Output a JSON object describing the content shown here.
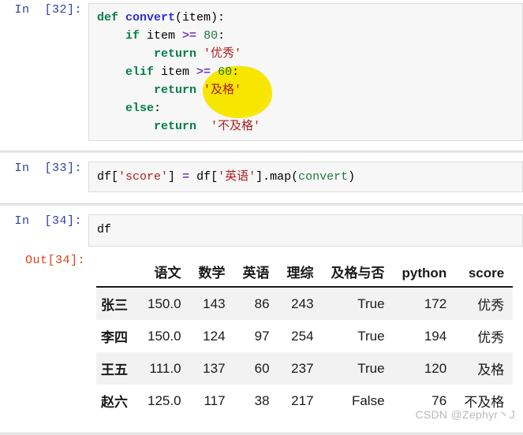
{
  "cells": [
    {
      "prompt": "In  [32]:",
      "type": "code",
      "code_lines": [
        {
          "tokens": [
            {
              "t": "def ",
              "c": "kw"
            },
            {
              "t": "convert",
              "c": "fn"
            },
            {
              "t": "(item):",
              "c": "punct"
            }
          ]
        },
        {
          "indent": 1,
          "tokens": [
            {
              "t": "if ",
              "c": "kw"
            },
            {
              "t": "item ",
              "c": "name"
            },
            {
              "t": ">=",
              "c": "op"
            },
            {
              "t": " ",
              "c": "name"
            },
            {
              "t": "80",
              "c": "num"
            },
            {
              "t": ":",
              "c": "punct"
            }
          ]
        },
        {
          "indent": 2,
          "tokens": [
            {
              "t": "return ",
              "c": "kw"
            },
            {
              "t": "'优秀'",
              "c": "str"
            }
          ]
        },
        {
          "indent": 1,
          "tokens": [
            {
              "t": "elif ",
              "c": "kw"
            },
            {
              "t": "item ",
              "c": "name"
            },
            {
              "t": ">=",
              "c": "op"
            },
            {
              "t": " ",
              "c": "name"
            },
            {
              "t": "60",
              "c": "num"
            },
            {
              "t": ":",
              "c": "punct"
            }
          ]
        },
        {
          "indent": 2,
          "tokens": [
            {
              "t": "return ",
              "c": "kw"
            },
            {
              "t": "'及格'",
              "c": "str"
            }
          ]
        },
        {
          "indent": 1,
          "tokens": [
            {
              "t": "else",
              "c": "kw"
            },
            {
              "t": ":",
              "c": "punct"
            }
          ]
        },
        {
          "indent": 2,
          "tokens": [
            {
              "t": "return ",
              "c": "kw"
            },
            {
              "t": " '不及格'",
              "c": "str"
            }
          ]
        }
      ]
    },
    {
      "prompt": "In  [33]:",
      "type": "code",
      "code_lines": [
        {
          "tokens": [
            {
              "t": "df[",
              "c": "name"
            },
            {
              "t": "'score'",
              "c": "str"
            },
            {
              "t": "] ",
              "c": "punct"
            },
            {
              "t": "=",
              "c": "op"
            },
            {
              "t": " df[",
              "c": "name"
            },
            {
              "t": "'英语'",
              "c": "str"
            },
            {
              "t": "].",
              "c": "punct"
            },
            {
              "t": "map",
              "c": "meth"
            },
            {
              "t": "(",
              "c": "punct"
            },
            {
              "t": "convert",
              "c": "builtin"
            },
            {
              "t": ")",
              "c": "punct"
            }
          ]
        }
      ]
    },
    {
      "prompt": "In  [34]:",
      "type": "code",
      "code_lines": [
        {
          "tokens": [
            {
              "t": "df",
              "c": "name"
            }
          ]
        }
      ]
    }
  ],
  "output": {
    "prompt": "Out[34]:",
    "table": {
      "index_header": "",
      "columns": [
        "语文",
        "数学",
        "英语",
        "理综",
        "及格与否",
        "python",
        "score"
      ],
      "rows": [
        {
          "index": "张三",
          "values": [
            "150.0",
            "143",
            "86",
            "243",
            "True",
            "172",
            "优秀"
          ]
        },
        {
          "index": "李四",
          "values": [
            "150.0",
            "124",
            "97",
            "254",
            "True",
            "194",
            "优秀"
          ]
        },
        {
          "index": "王五",
          "values": [
            "111.0",
            "137",
            "60",
            "237",
            "True",
            "120",
            "及格"
          ]
        },
        {
          "index": "赵六",
          "values": [
            "125.0",
            "117",
            "38",
            "217",
            "False",
            "76",
            "不及格"
          ]
        }
      ]
    }
  },
  "watermark": "CSDN @Zephyr丶J",
  "colors": {
    "keyword": "#007f49",
    "function": "#3030d0",
    "string": "#b02020",
    "operator": "#7b3fbf",
    "number": "#1b7a3d",
    "in_prompt": "#303f9f",
    "out_prompt": "#d84315",
    "cell_background": "#f7f7f7",
    "highlighter": "#ffee00",
    "row_stripe": "#f2f2f2"
  }
}
